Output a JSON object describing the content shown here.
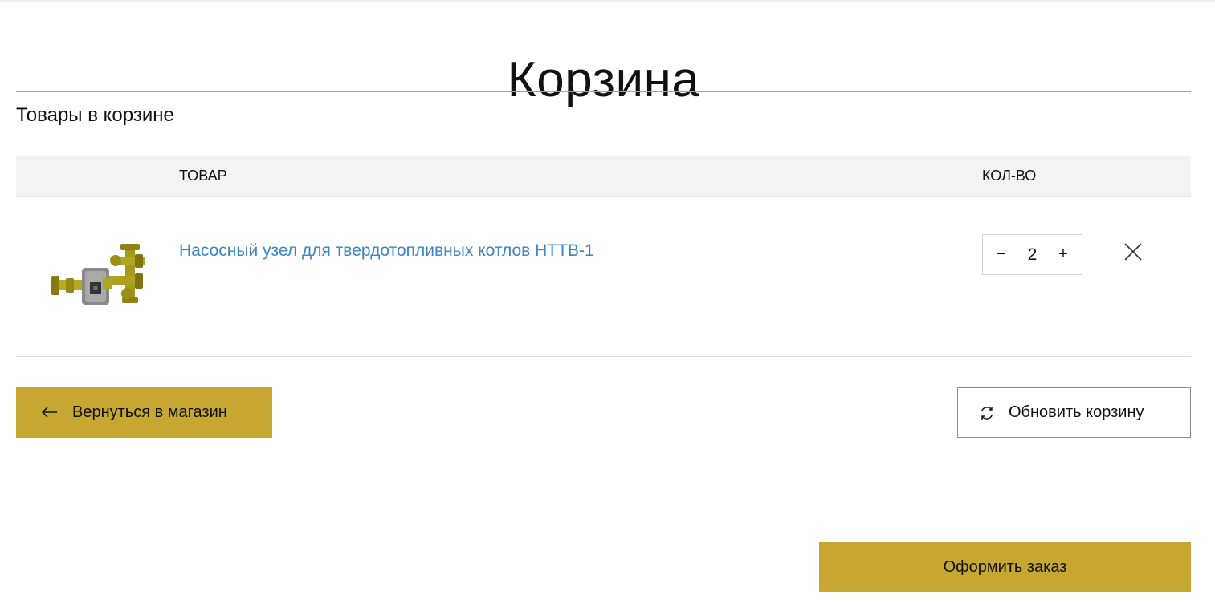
{
  "page": {
    "title": "Корзина",
    "section_title": "Товары в корзине"
  },
  "table": {
    "headers": {
      "product": "ТОВАР",
      "qty": "КОЛ-ВО"
    },
    "rows": [
      {
        "name": "Насосный узел для твердотопливных котлов НТТВ-1",
        "quantity": "2",
        "minus": "−",
        "plus": "+"
      }
    ]
  },
  "actions": {
    "back": "Вернуться в магазин",
    "refresh": "Обновить корзину",
    "checkout": "Оформить заказ"
  },
  "colors": {
    "accent": "#c5a731",
    "link": "#3a86c8",
    "header_bg": "#f3f3f3"
  },
  "icons": {
    "back": "arrow-left-icon",
    "refresh": "refresh-icon",
    "remove": "close-icon",
    "thumb": "pump-unit-product-image"
  }
}
